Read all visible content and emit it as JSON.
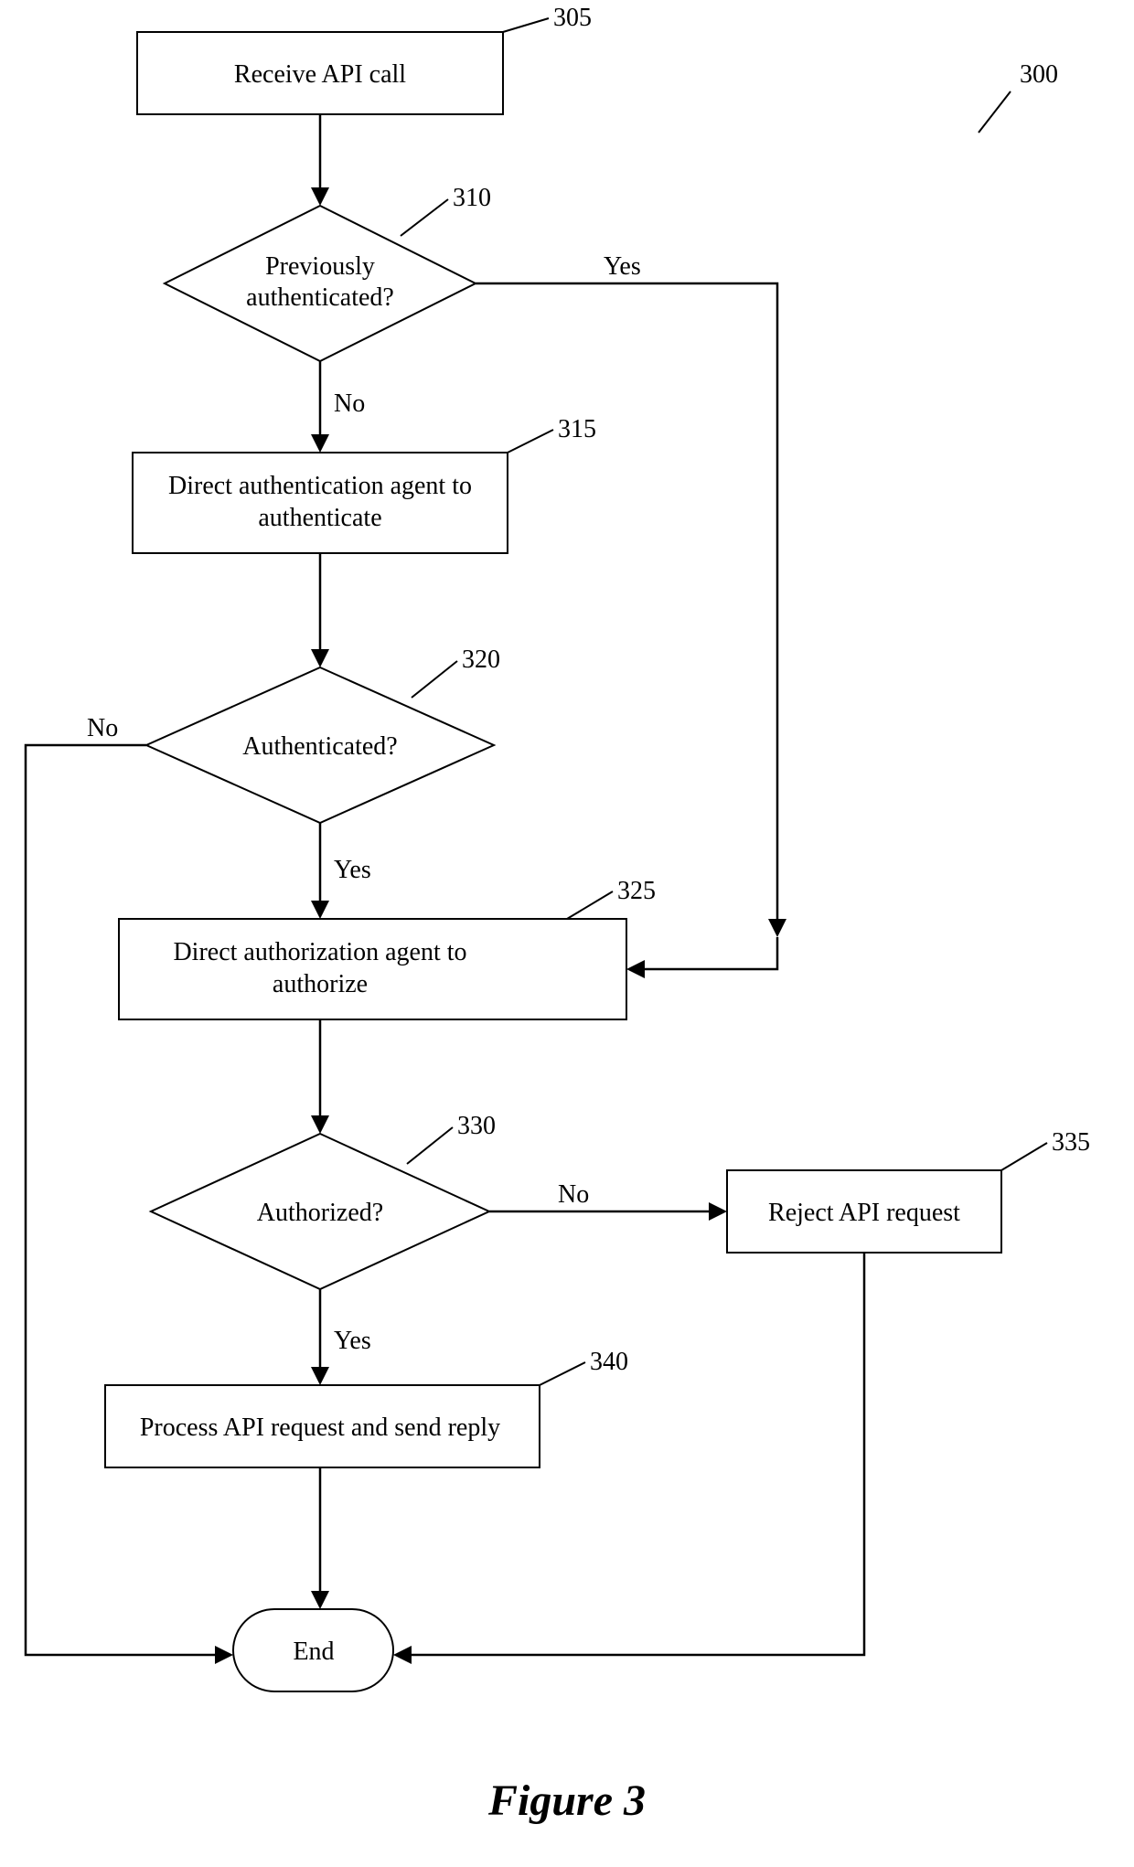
{
  "figure_ref": "300",
  "caption": "Figure 3",
  "nodes": {
    "n305": {
      "ref": "305",
      "text": "Receive API call"
    },
    "n310": {
      "ref": "310",
      "text1": "Previously",
      "text2": "authenticated?"
    },
    "n315": {
      "ref": "315",
      "text1": "Direct authentication agent to",
      "text2": "authenticate"
    },
    "n320": {
      "ref": "320",
      "text": "Authenticated?"
    },
    "n325": {
      "ref": "325",
      "text1": "Direct authorization agent to",
      "text2": "authorize"
    },
    "n330": {
      "ref": "330",
      "text": "Authorized?"
    },
    "n335": {
      "ref": "335",
      "text": "Reject API request"
    },
    "n340": {
      "ref": "340",
      "text": "Process API request and send reply"
    },
    "end": {
      "text": "End"
    }
  },
  "labels": {
    "yes": "Yes",
    "no": "No"
  }
}
